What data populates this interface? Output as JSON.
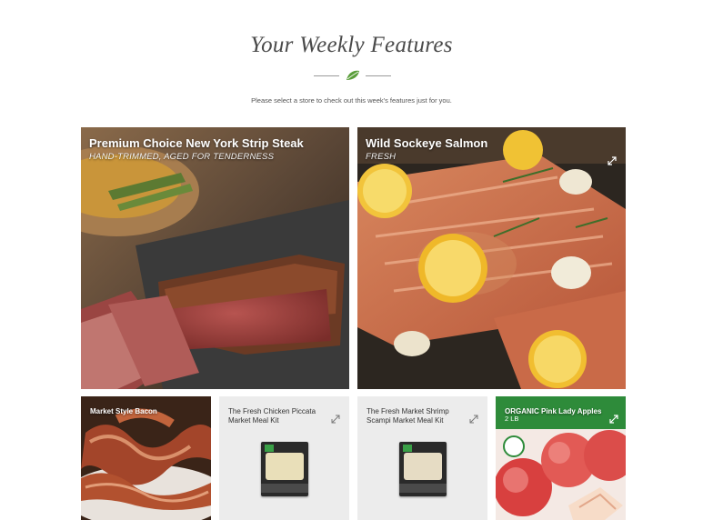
{
  "header": {
    "title": "Your Weekly Features",
    "subtitle": "Please select a store to check out this week's features just for you."
  },
  "features": {
    "steak": {
      "title": "Premium Choice New York Strip Steak",
      "subtitle": "HAND-TRIMMED, AGED FOR TENDERNESS"
    },
    "salmon": {
      "title": "Wild Sockeye Salmon",
      "subtitle": "FRESH"
    },
    "bacon": {
      "title": "Market Style Bacon"
    },
    "chicken": {
      "title": "The Fresh Chicken Piccata Market Meal Kit"
    },
    "shrimp": {
      "title": "The Fresh Market Shrimp Scampi Market Meal Kit"
    },
    "apples": {
      "title": "ORGANIC Pink Lady Apples",
      "subtitle": "2 LB"
    }
  },
  "icons": {
    "leaf": "leaf-icon",
    "expand": "expand-icon"
  },
  "colors": {
    "accent_green": "#2e8b3a",
    "leaf_green": "#5a9e3a",
    "tile_gray": "#ececec"
  }
}
